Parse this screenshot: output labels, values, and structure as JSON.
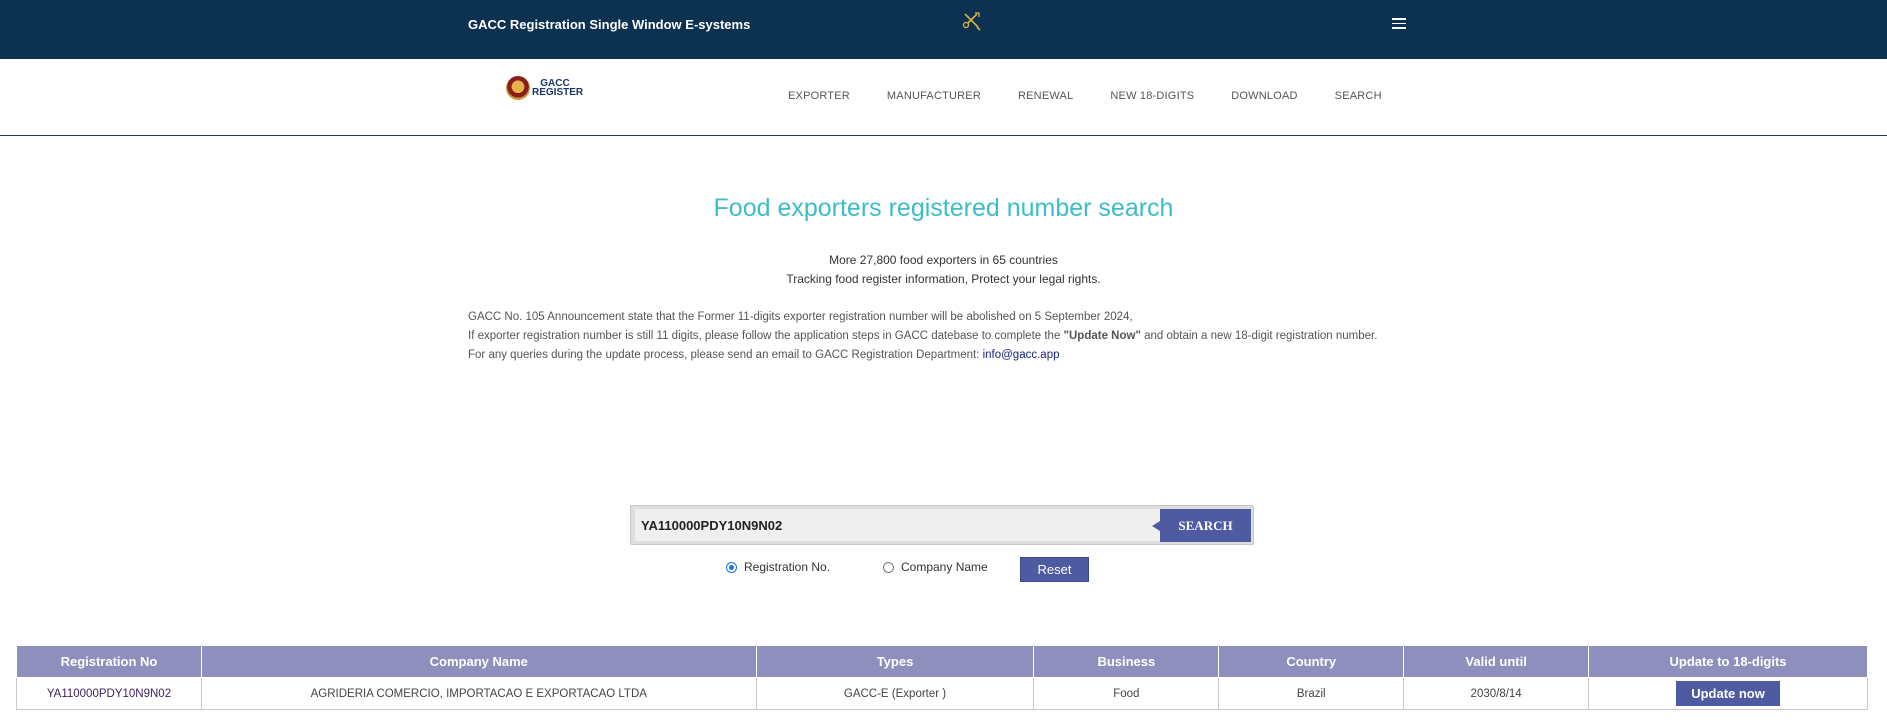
{
  "topbar": {
    "title": "GACC Registration Single Window E-systems"
  },
  "logo": {
    "line1": "GACC",
    "line2": "REGISTER"
  },
  "nav": {
    "items": [
      "EXPORTER",
      "MANUFACTURER",
      "RENEWAL",
      "NEW 18-DIGITS",
      "DOWNLOAD",
      "SEARCH"
    ]
  },
  "hero": {
    "heading": "Food exporters registered number search",
    "sub1": "More 27,800 food exporters in 65 countries",
    "sub2": "Tracking food register information, Protect your legal rights."
  },
  "notice": {
    "line1": "GACC No. 105 Announcement state that the Former 11-digits exporter registration number will be abolished on 5 September 2024,",
    "line2_a": "If exporter registration number is still 11 digits, please follow the application steps in GACC datebase to complete the ",
    "line2_bold": "\"Update Now\"",
    "line2_b": " and obtain a new 18-digit registration number.",
    "line3": "For any queries during the update process, please send an email to GACC Registration Department: ",
    "email": "info@gacc.app"
  },
  "search": {
    "value": "YA110000PDY10N9N02",
    "button": "SEARCH",
    "radio_reg": "Registration No.",
    "radio_company": "Company Name",
    "selected": "Registration No.",
    "reset": "Reset"
  },
  "table": {
    "headers": [
      "Registration No",
      "Company Name",
      "Types",
      "Business",
      "Country",
      "Valid until",
      "Update to 18-digits"
    ],
    "rows": [
      {
        "reg_no": "YA110000PDY10N9N02",
        "company": "AGRIDERIA COMERCIO, IMPORTACAO E EXPORTACAO LTDA",
        "types": "GACC-E (Exporter )",
        "business": "Food",
        "country": "Brazil",
        "valid_until": "2030/8/14",
        "action": "Update now"
      }
    ]
  },
  "colors": {
    "topbar": "#0d3150",
    "heading": "#3dbdc9",
    "button": "#4f5ba0",
    "table_header": "#8f8fbd"
  }
}
